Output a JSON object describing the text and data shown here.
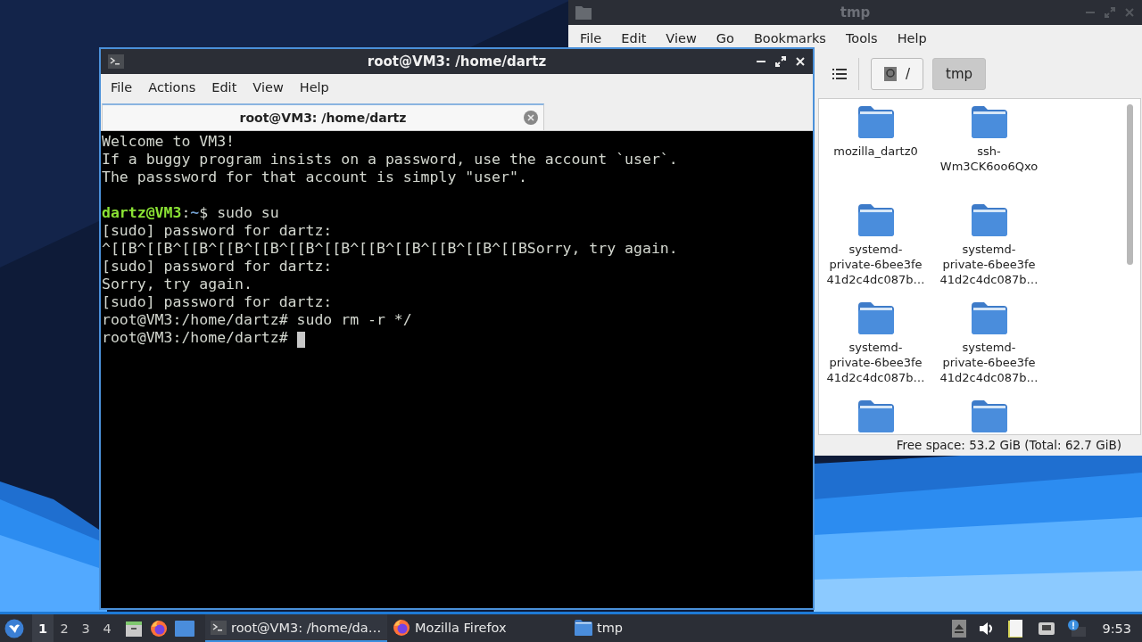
{
  "terminal_window": {
    "title": "root@VM3: /home/dartz",
    "active": true,
    "menu": [
      "File",
      "Actions",
      "Edit",
      "View",
      "Help"
    ],
    "tabs": [
      {
        "label": "root@VM3: /home/dartz",
        "selected": true
      }
    ],
    "lines": [
      {
        "segments": [
          {
            "text": "Welcome to VM3!",
            "color": "#d3d7cf"
          }
        ]
      },
      {
        "segments": [
          {
            "text": "If a buggy program insists on a password, use the account `user`.",
            "color": "#d3d7cf"
          }
        ]
      },
      {
        "segments": [
          {
            "text": "The passsword for that account is simply \"user\".",
            "color": "#d3d7cf"
          }
        ]
      },
      {
        "kind": "blank"
      },
      {
        "segments": [
          {
            "text": "dartz@VM3",
            "color": "#8ae234",
            "bold": true
          },
          {
            "text": ":",
            "color": "#d3d7cf"
          },
          {
            "text": "~",
            "color": "#729fcf",
            "bold": true
          },
          {
            "text": "$ sudo su",
            "color": "#d3d7cf"
          }
        ]
      },
      {
        "segments": [
          {
            "text": "[sudo] password for dartz:",
            "color": "#d3d7cf"
          }
        ]
      },
      {
        "segments": [
          {
            "text": "^[[B^[[B^[[B^[[B^[[B^[[B^[[B^[[B^[[B^[[B^[[B^[[BSorry, try again.",
            "color": "#d3d7cf"
          }
        ]
      },
      {
        "segments": [
          {
            "text": "[sudo] password for dartz:",
            "color": "#d3d7cf"
          }
        ]
      },
      {
        "segments": [
          {
            "text": "Sorry, try again.",
            "color": "#d3d7cf"
          }
        ]
      },
      {
        "segments": [
          {
            "text": "[sudo] password for dartz:",
            "color": "#d3d7cf"
          }
        ]
      },
      {
        "segments": [
          {
            "text": "root@VM3:/home/dartz# sudo rm -r */",
            "color": "#d3d7cf"
          }
        ]
      },
      {
        "segments": [
          {
            "text": "root@VM3:/home/dartz# ",
            "color": "#d3d7cf"
          }
        ],
        "cursor": true
      }
    ]
  },
  "file_manager": {
    "title": "tmp",
    "active": false,
    "menu": [
      "File",
      "Edit",
      "View",
      "Go",
      "Bookmarks",
      "Tools",
      "Help"
    ],
    "path": [
      {
        "label": "/",
        "kind": "root",
        "selected": false
      },
      {
        "label": "tmp",
        "kind": "folder",
        "selected": true
      }
    ],
    "files": [
      {
        "kind": "folder",
        "name_lines": [
          "mozilla_dartz0"
        ]
      },
      {
        "kind": "folder",
        "name_lines": [
          "ssh-",
          "Wm3CK6oo6Qxo"
        ]
      },
      {
        "kind": "folder",
        "name_lines": [
          "systemd-",
          "private-6bee3fe",
          "41d2c4dc087b…"
        ]
      },
      {
        "kind": "folder",
        "name_lines": [
          "systemd-",
          "private-6bee3fe",
          "41d2c4dc087b…"
        ]
      },
      {
        "kind": "folder",
        "name_lines": [
          "systemd-",
          "private-6bee3fe",
          "41d2c4dc087b…"
        ]
      },
      {
        "kind": "folder",
        "name_lines": [
          "systemd-",
          "private-6bee3fe",
          "41d2c4dc087b…"
        ]
      },
      {
        "kind": "folder"
      },
      {
        "kind": "folder"
      }
    ],
    "status": "Free space: 53.2 GiB (Total: 62.7 GiB)"
  },
  "taskbar": {
    "workspaces": [
      {
        "label": "1",
        "selected": true
      },
      {
        "label": "2",
        "selected": false
      },
      {
        "label": "3",
        "selected": false
      },
      {
        "label": "4",
        "selected": false
      }
    ],
    "tasks": [
      {
        "label": "root@VM3: /home/da…",
        "kind": "terminal",
        "selected": true
      },
      {
        "label": "Mozilla Firefox",
        "kind": "browser",
        "selected": false
      },
      {
        "label": "tmp",
        "kind": "folder",
        "selected": false
      }
    ],
    "clock": "9:53"
  }
}
